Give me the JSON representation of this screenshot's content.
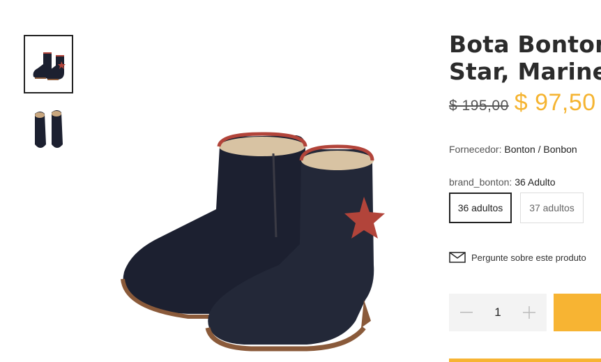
{
  "product": {
    "title": "Bota Bonton\nStar, Marine",
    "price_old": "$ 195,00",
    "price_new": "$ 97,50"
  },
  "vendor": {
    "label": "Fornecedor:",
    "value": "Bonton / Bonbon"
  },
  "variant": {
    "label": "brand_bonton:",
    "value": "36 Adulto",
    "options": [
      "36 adultos",
      "37 adultos"
    ]
  },
  "ask_link": {
    "label": "Pergunte sobre este produto",
    "icon": "mail-icon"
  },
  "quantity": {
    "value": "1"
  },
  "colors": {
    "accent": "#f7b433",
    "price": "#f5b431",
    "boot": "#1c2030",
    "trim": "#b2443a"
  }
}
